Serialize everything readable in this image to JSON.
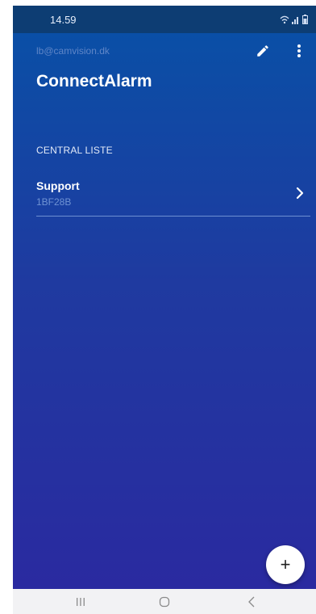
{
  "status_bar": {
    "time": "14.59",
    "icons": [
      "wifi-icon",
      "signal-icon",
      "battery-icon"
    ]
  },
  "header": {
    "account_email": "lb@camvision.dk",
    "title": "ConnectAlarm",
    "actions": [
      "edit-icon",
      "more-vert-icon"
    ]
  },
  "central_list": {
    "section_title": "CENTRAL LISTE",
    "items": [
      {
        "name": "Support",
        "id": "1BF28B"
      }
    ]
  },
  "fab": {
    "label": "+"
  },
  "nav_bar": {
    "buttons": [
      "recent-apps-icon",
      "home-icon",
      "back-icon"
    ]
  },
  "colors": {
    "status_bar": "#0d3d73",
    "gradient_top": "#0a4fa6",
    "gradient_bottom": "#2a2aa0",
    "text_primary": "#ffffff",
    "text_secondary": "#6f92d3"
  }
}
